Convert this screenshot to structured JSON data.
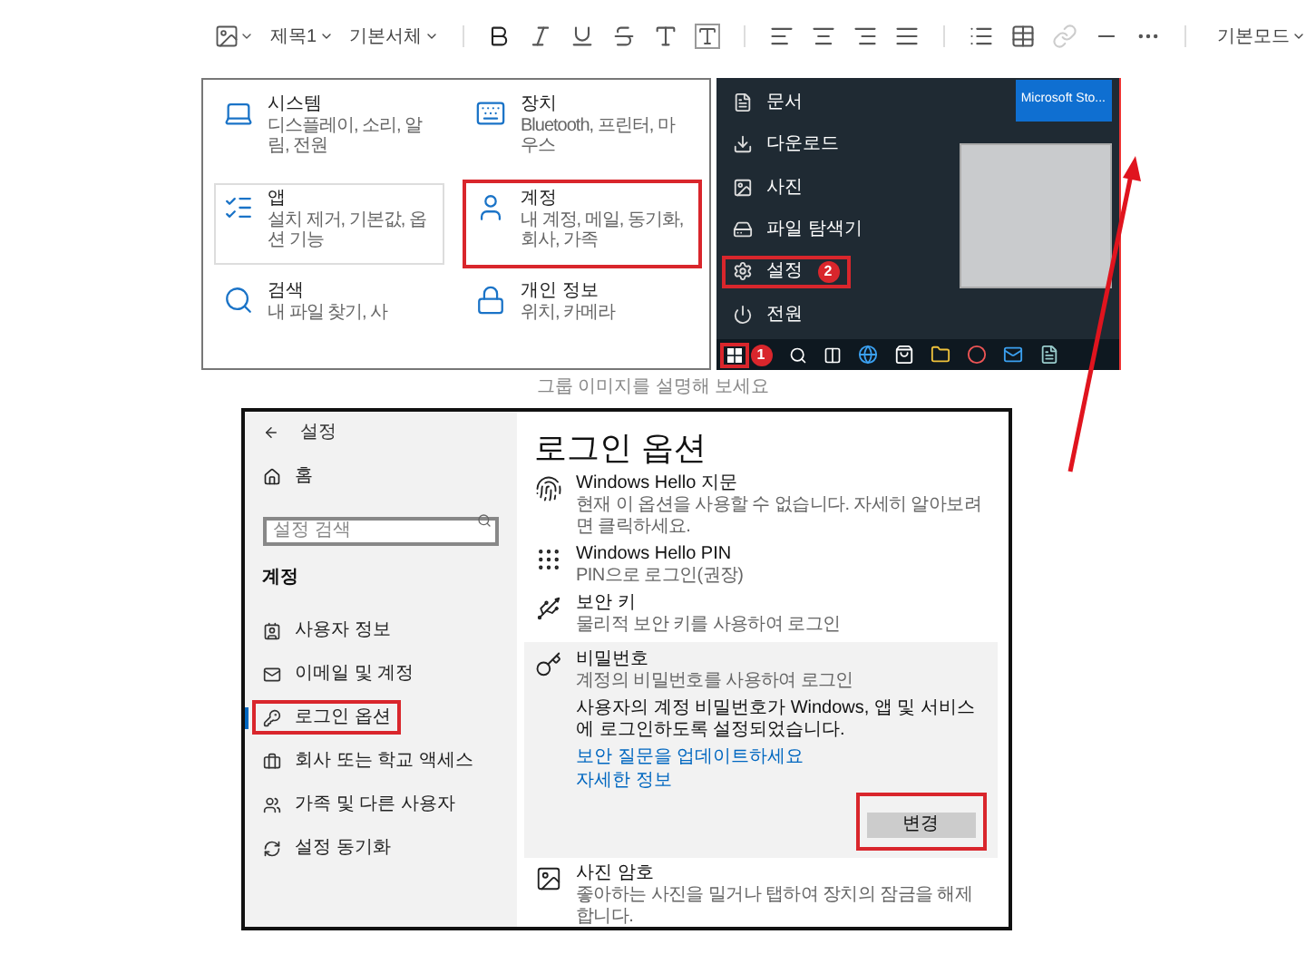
{
  "toolbar": {
    "heading_style": "제목1",
    "font": "기본서체",
    "mode": "기본모드"
  },
  "image_1": {
    "tiles": [
      {
        "title": "시스템",
        "description": "디스플레이, 소리, 알림, 전원",
        "outlined": false,
        "highlighted": false
      },
      {
        "title": "장치",
        "description": "Bluetooth, 프린터, 마우스",
        "outlined": false,
        "highlighted": false
      },
      {
        "title": "앱",
        "description": "설치 제거, 기본값, 옵션 기능",
        "outlined": true,
        "highlighted": false
      },
      {
        "title": "계정",
        "description": "내 계정, 메일, 동기화, 회사, 가족",
        "outlined": false,
        "highlighted": true
      },
      {
        "title": "검색",
        "description": "내 파일 찾기, 사",
        "outlined": false,
        "highlighted": false
      },
      {
        "title": "개인 정보",
        "description": "위치, 카메라",
        "outlined": false,
        "highlighted": false
      }
    ]
  },
  "image_2": {
    "menu": [
      {
        "label": "문서",
        "highlighted": false
      },
      {
        "label": "다운로드",
        "highlighted": false
      },
      {
        "label": "사진",
        "highlighted": false
      },
      {
        "label": "파일 탐색기",
        "highlighted": false
      },
      {
        "label": "설정",
        "highlighted": true,
        "step": "2"
      },
      {
        "label": "전원",
        "highlighted": false
      }
    ],
    "tile": "Microsoft Sto...",
    "start_highlighted": true,
    "start_step": "1"
  },
  "caption": "그룹 이미지를 설명해 보세요",
  "image_3": {
    "back_title": "설정",
    "home": "홈",
    "search_placeholder": "설정 검색",
    "section": "계정",
    "nav": [
      {
        "label": "사용자 정보",
        "selected": false,
        "highlighted": false
      },
      {
        "label": "이메일 및 계정",
        "selected": false,
        "highlighted": false
      },
      {
        "label": "로그인 옵션",
        "selected": true,
        "highlighted": true
      },
      {
        "label": "회사 또는 학교 액세스",
        "selected": false,
        "highlighted": false
      },
      {
        "label": "가족 및 다른 사용자",
        "selected": false,
        "highlighted": false
      },
      {
        "label": "설정 동기화",
        "selected": false,
        "highlighted": false
      }
    ],
    "title": "로그인 옵션",
    "options": [
      {
        "title": "Windows Hello 지문",
        "description": "현재 이 옵션을 사용할 수 없습니다. 자세히 알아보려면 클릭하세요.",
        "expanded": false
      },
      {
        "title": "Windows Hello PIN",
        "description": "PIN으로 로그인(권장)",
        "expanded": false
      },
      {
        "title": "보안 키",
        "description": "물리적 보안 키를 사용하여 로그인",
        "expanded": false
      },
      {
        "title": "비밀번호",
        "description": "계정의 비밀번호를 사용하여 로그인",
        "expanded": true,
        "message": "사용자의 계정 비밀번호가 Windows, 앱 및 서비스에 로그인하도록 설정되었습니다.",
        "links": [
          "보안 질문을 업데이트하세요",
          "자세한 정보"
        ],
        "button": "변경",
        "button_highlighted": true
      },
      {
        "title": "사진 암호",
        "description": "좋아하는 사진을 밀거나 탭하여 장치의 잠금을 해제합니다.",
        "expanded": false
      }
    ]
  }
}
